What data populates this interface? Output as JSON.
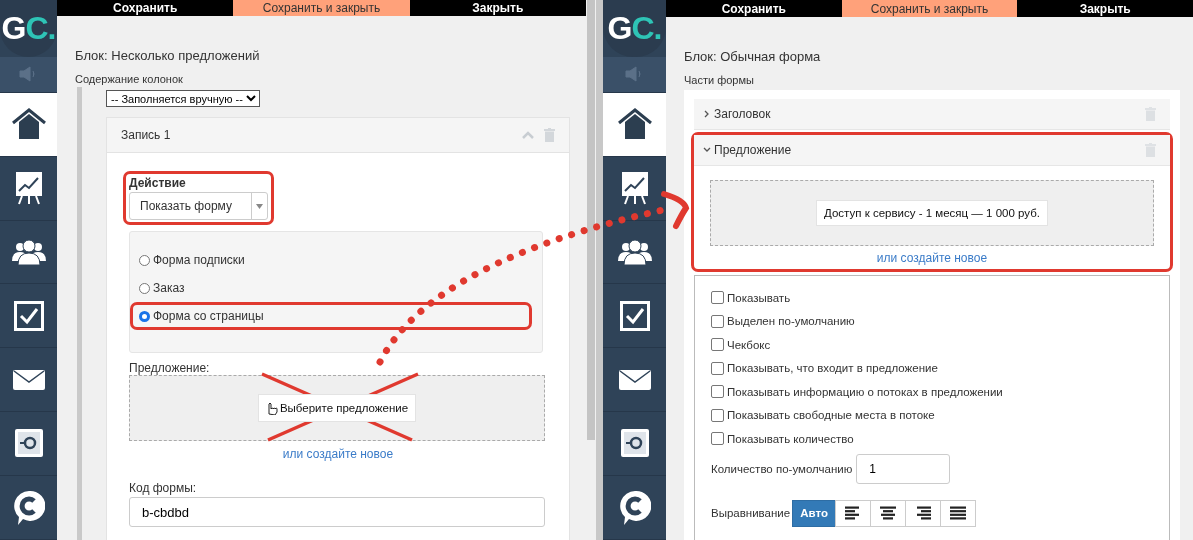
{
  "left_panel": {
    "logo": {
      "letter_1": "G",
      "letter_2": "C",
      "dot": "."
    },
    "sidebar": [
      {
        "kind": "speaker",
        "selected": false
      },
      {
        "kind": "home",
        "selected": true
      },
      {
        "kind": "chart",
        "selected": false
      },
      {
        "kind": "people",
        "selected": false
      },
      {
        "kind": "check",
        "selected": false
      },
      {
        "kind": "mail",
        "selected": false
      },
      {
        "kind": "safe",
        "selected": false
      },
      {
        "kind": "chat",
        "selected": false
      }
    ],
    "toolbar": [
      {
        "label": "Сохранить",
        "highlighted": false
      },
      {
        "label": "Сохранить и закрыть",
        "highlighted": true
      },
      {
        "label": "Закрыть",
        "highlighted": false
      }
    ],
    "block_title": "Блок: Несколько предложений",
    "section_label": "Содержание колонок",
    "source_select": "-- Заполняется вручную --",
    "record": {
      "title": "Запись 1",
      "action_label": "Действие",
      "action_value": "Показать форму",
      "action_highlighted": true,
      "radios": [
        {
          "label": "Форма подписки",
          "selected": false,
          "highlighted": false
        },
        {
          "label": "Заказ",
          "selected": false,
          "highlighted": false
        },
        {
          "label": "Форма со страницы",
          "selected": true,
          "highlighted": true
        }
      ],
      "offer_label": "Предложение:",
      "offer_button": "Выберите предложение",
      "crossed_out": true,
      "create_link": "или создайте новое",
      "code_label": "Код формы:",
      "code_value": "b-cbdbd"
    }
  },
  "right_panel": {
    "logo": {
      "letter_1": "G",
      "letter_2": "C",
      "dot": "."
    },
    "sidebar": [
      {
        "kind": "speaker",
        "selected": false
      },
      {
        "kind": "home",
        "selected": true
      },
      {
        "kind": "chart",
        "selected": false
      },
      {
        "kind": "people",
        "selected": false
      },
      {
        "kind": "check",
        "selected": false
      },
      {
        "kind": "mail",
        "selected": false
      },
      {
        "kind": "safe",
        "selected": false
      },
      {
        "kind": "chat",
        "selected": false
      }
    ],
    "toolbar": [
      {
        "label": "Сохранить",
        "highlighted": false
      },
      {
        "label": "Сохранить и закрыть",
        "highlighted": true
      },
      {
        "label": "Закрыть",
        "highlighted": false
      }
    ],
    "block_title": "Блок: Обычная форма",
    "section_label": "Части формы",
    "parts": [
      {
        "title": "Заголовок",
        "expanded": false,
        "highlighted": false
      },
      {
        "title": "Предложение",
        "expanded": true,
        "highlighted": true,
        "offer": "Доступ к сервису - 1 месяц — 1 000 руб.",
        "create_link": "или создайте новое"
      }
    ],
    "checkboxes": [
      {
        "label": "Показывать",
        "checked": false
      },
      {
        "label": "Выделен по-умолчанию",
        "checked": false
      },
      {
        "label": "Чекбокс",
        "checked": false
      },
      {
        "label": "Показывать, что входит в предложение",
        "checked": false
      },
      {
        "label": "Показывать информацию о потоках в предложении",
        "checked": false
      },
      {
        "label": "Показывать свободные места в потоке",
        "checked": false
      },
      {
        "label": "Показывать количество",
        "checked": false
      }
    ],
    "quantity_label": "Количество по-умолчанию",
    "quantity_value": "1",
    "align_label": "Выравнивание",
    "align_buttons": [
      {
        "kind": "text",
        "label": "Авто",
        "selected": true
      },
      {
        "kind": "left",
        "selected": false
      },
      {
        "kind": "center",
        "selected": false
      },
      {
        "kind": "right",
        "selected": false
      },
      {
        "kind": "justify",
        "selected": false
      }
    ]
  }
}
